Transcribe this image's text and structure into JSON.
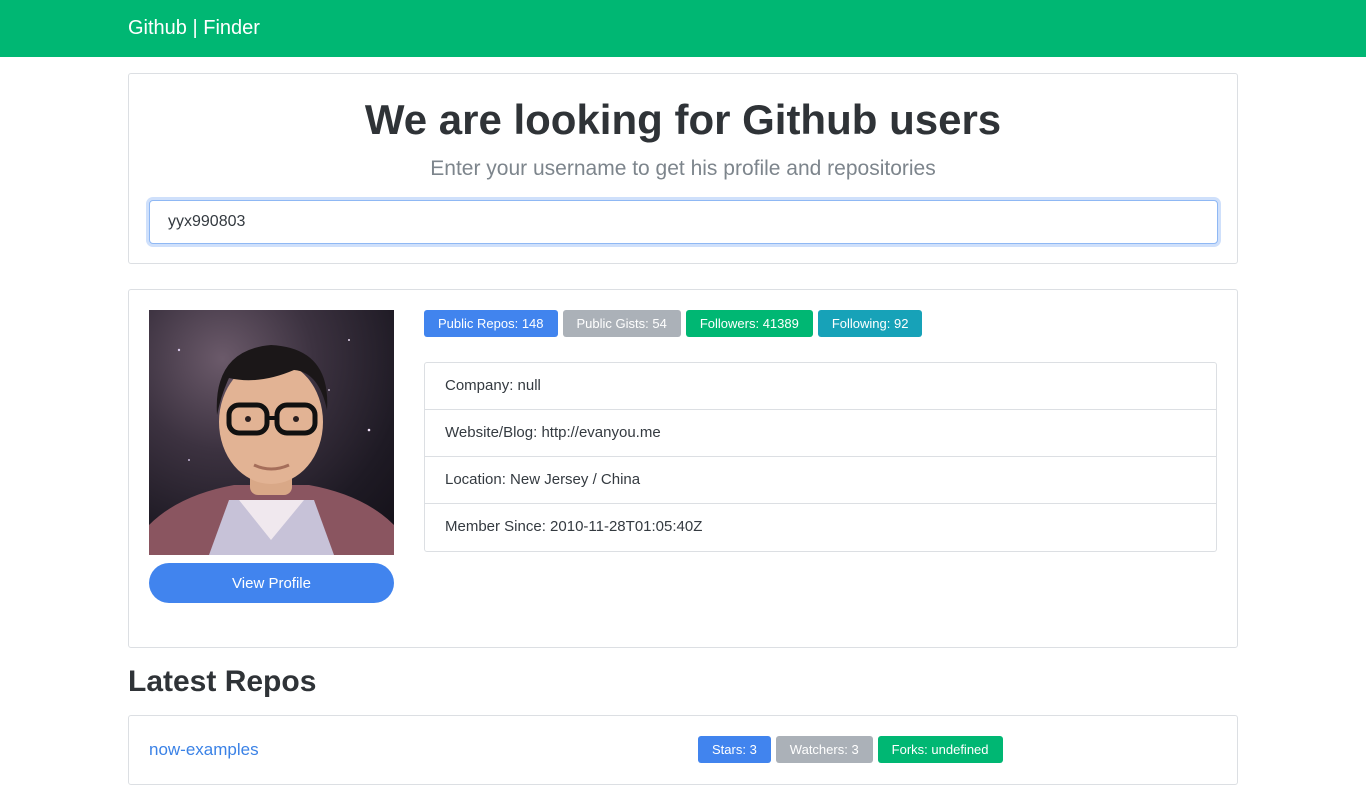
{
  "navbar": {
    "brand": "Github | Finder"
  },
  "search": {
    "title": "We are looking for Github users",
    "subtitle": "Enter your username to get his profile and repositories",
    "value": "yyx990803"
  },
  "profile": {
    "view_profile_label": "View Profile",
    "badges": {
      "repos": "Public Repos: 148",
      "gists": "Public Gists: 54",
      "followers": "Followers: 41389",
      "following": "Following: 92"
    },
    "info": {
      "company": "Company: null",
      "website": "Website/Blog: http://evanyou.me",
      "location": "Location: New Jersey / China",
      "member_since": "Member Since: 2010-11-28T01:05:40Z"
    }
  },
  "repos": {
    "title": "Latest Repos",
    "items": [
      {
        "name": "now-examples",
        "stars": "Stars: 3",
        "watchers": "Watchers: 3",
        "forks": "Forks: undefined"
      }
    ]
  },
  "colors": {
    "navbar": "#00b773",
    "primary": "#4184ee",
    "secondary": "#abb1b8",
    "success": "#00b773",
    "info": "#17a2b8"
  },
  "icons": {
    "avatar": "user-photo"
  }
}
